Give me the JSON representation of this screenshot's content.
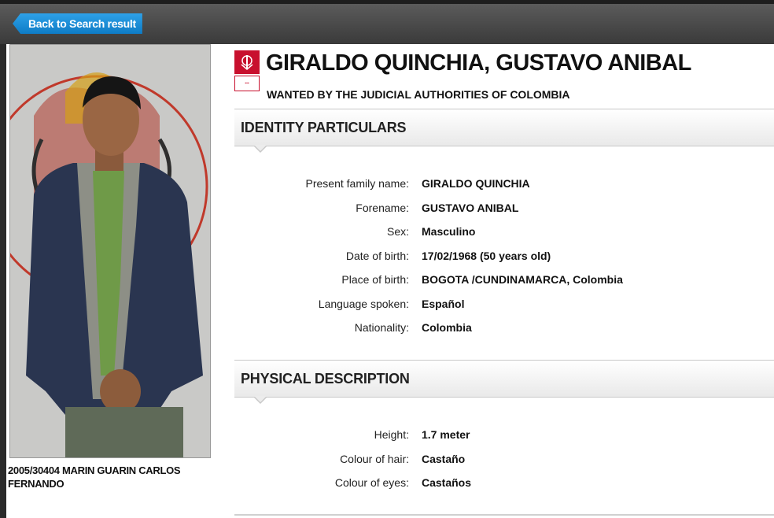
{
  "nav": {
    "back_label": "Back to Search result"
  },
  "profile": {
    "name": "GIRALDO QUINCHIA, GUSTAVO ANIBAL",
    "wanted_by": "WANTED BY THE JUDICIAL AUTHORITIES OF COLOMBIA",
    "photo_caption": "2005/30404 MARIN GUARIN CARLOS FERNANDO"
  },
  "identity": {
    "title": "IDENTITY PARTICULARS",
    "fields": [
      {
        "label": "Present family name:",
        "value": "GIRALDO QUINCHIA"
      },
      {
        "label": "Forename:",
        "value": "GUSTAVO ANIBAL"
      },
      {
        "label": "Sex:",
        "value": "Masculino"
      },
      {
        "label": "Date of birth:",
        "value": "17/02/1968 (50 years old)"
      },
      {
        "label": "Place of birth:",
        "value": "BOGOTA /CUNDINAMARCA, Colombia"
      },
      {
        "label": "Language spoken:",
        "value": "Español"
      },
      {
        "label": "Nationality:",
        "value": "Colombia"
      }
    ]
  },
  "physical": {
    "title": "PHYSICAL DESCRIPTION",
    "fields": [
      {
        "label": "Height:",
        "value": "1.7 meter"
      },
      {
        "label": "Colour of hair:",
        "value": "Castaño"
      },
      {
        "label": "Colour of eyes:",
        "value": "Castaños"
      }
    ]
  },
  "colors": {
    "accent": "#0e7cc6",
    "notice_red": "#c8102e",
    "topbar": "#3a3a3a"
  },
  "icons": [
    "interpol-red-notice-logo-icon"
  ]
}
